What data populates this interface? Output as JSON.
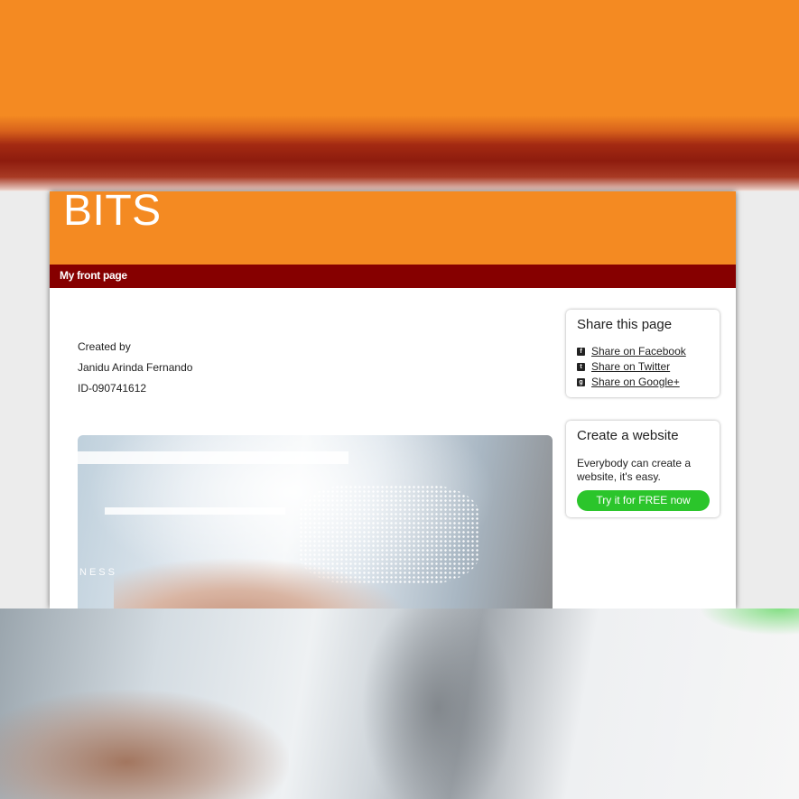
{
  "site": {
    "title": "BITS",
    "nav": {
      "items": [
        {
          "label": "My front page"
        }
      ]
    }
  },
  "intro": {
    "created_by_label": "Created by",
    "author_name": "Janidu Arinda Fernando",
    "author_id": "ID-090741612"
  },
  "hero": {
    "image_icon": "business-network-photo",
    "overlay_text_left": "NESS"
  },
  "sidebar": {
    "share": {
      "title": "Share this page",
      "links": [
        {
          "label": "Share on Facebook",
          "icon": "facebook-icon",
          "glyph": "f"
        },
        {
          "label": "Share on Twitter",
          "icon": "twitter-icon",
          "glyph": "t"
        },
        {
          "label": "Share on Google+",
          "icon": "google-plus-icon",
          "glyph": "g"
        }
      ]
    },
    "create": {
      "title": "Create a website",
      "description": "Everybody can create a website, it's easy.",
      "button_label": "Try it for FREE now"
    }
  },
  "colors": {
    "header_orange": "#f48a22",
    "nav_dark_red": "#860000",
    "cta_green": "#2bc52b"
  }
}
